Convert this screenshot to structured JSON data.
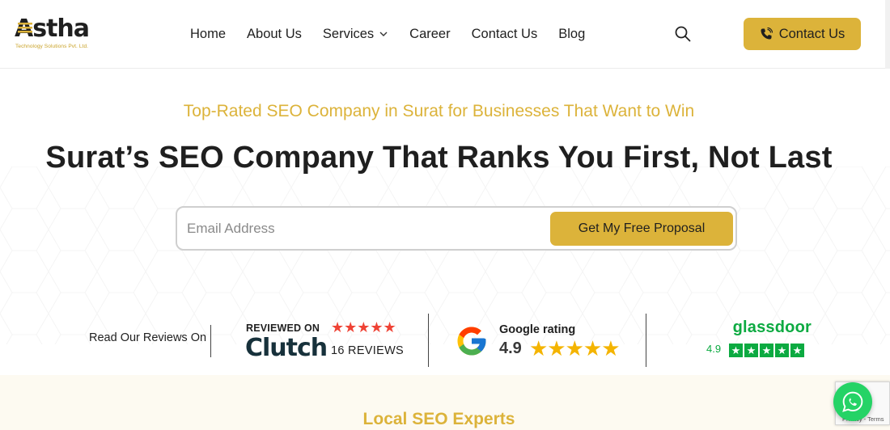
{
  "brand": {
    "name": "Astha",
    "logo_word": "Astha",
    "tagline": "Technology Solutions Pvt. Ltd."
  },
  "nav": {
    "items": [
      {
        "label": "Home"
      },
      {
        "label": "About Us"
      },
      {
        "label": "Services",
        "has_dropdown": true
      },
      {
        "label": "Career"
      },
      {
        "label": "Contact Us"
      },
      {
        "label": "Blog"
      }
    ],
    "search_icon": "search-icon",
    "cta_label": "Contact Us",
    "cta_icon": "phone-icon"
  },
  "hero": {
    "eyebrow": "Top-Rated SEO Company in Surat for Businesses That Want to Win",
    "headline": "Surat’s SEO Company That Ranks You First, Not Last",
    "email_placeholder": "Email Address",
    "email_value": "",
    "submit_label": "Get My Free Proposal"
  },
  "reviews": {
    "label": "Read Our Reviews On",
    "clutch": {
      "reviewed_on": "REVIEWED ON",
      "name": "Clutch",
      "count_text": "16 REVIEWS",
      "stars": "★★★★★"
    },
    "google": {
      "title": "Google rating",
      "score": "4.9",
      "stars": "★★★★★"
    },
    "glassdoor": {
      "name": "glassdoor",
      "score": "4.9",
      "stars": [
        "★",
        "★",
        "★",
        "★",
        "★"
      ]
    }
  },
  "section2": {
    "title": "Local SEO Experts"
  },
  "recaptcha": {
    "text": "Privacy - Terms"
  },
  "colors": {
    "accent": "#dcb33a",
    "text": "#1f1f1f",
    "clutch_red": "#ef4335",
    "glassdoor_green": "#0caa41",
    "google_star": "#f4b400",
    "whatsapp": "#25d366"
  }
}
